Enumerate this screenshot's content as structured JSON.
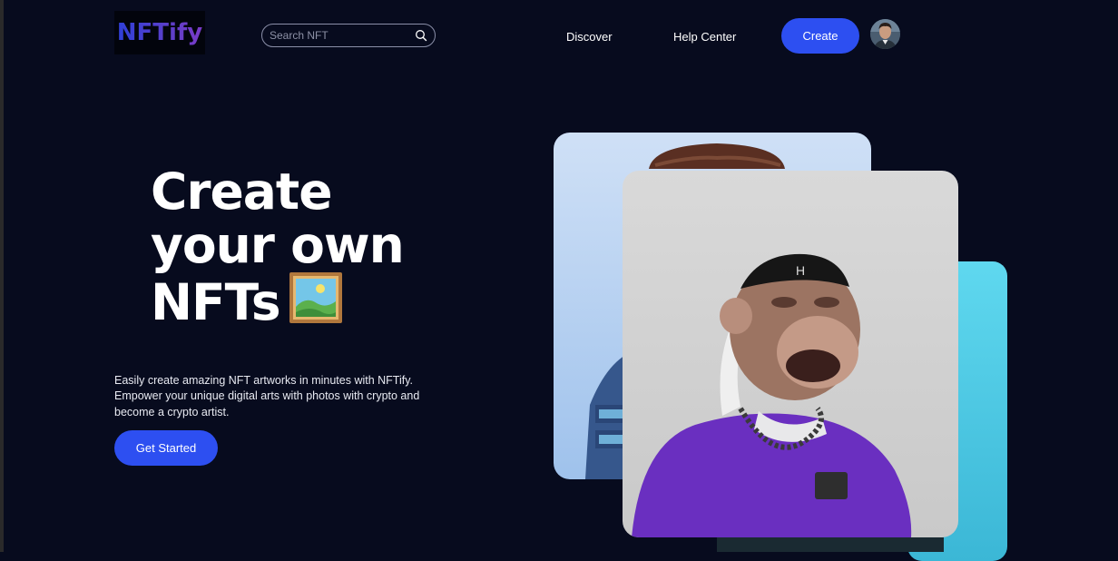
{
  "header": {
    "logo": "NFTify",
    "search": {
      "placeholder": "Search NFT",
      "value": ""
    },
    "nav": [
      {
        "label": "Discover"
      },
      {
        "label": "Help Center"
      }
    ],
    "create_label": "Create",
    "avatar_icon": "user-avatar"
  },
  "hero": {
    "title_lines": [
      "Create",
      "your own",
      "NFTs"
    ],
    "title_emoji_icon": "framed-picture-icon",
    "description": "Easily create amazing NFT artworks in minutes with NFTify. Empower your unique digital arts with photos with crypto and become a crypto artist.",
    "cta_label": "Get Started"
  },
  "colors": {
    "background": "#070b1e",
    "accent": "#2d4ff1",
    "card_cyan": "#4fcde6",
    "card_blue": "#b8d2f2",
    "card_grey": "#d4d4d4",
    "shirt_purple": "#6a2fc0"
  }
}
